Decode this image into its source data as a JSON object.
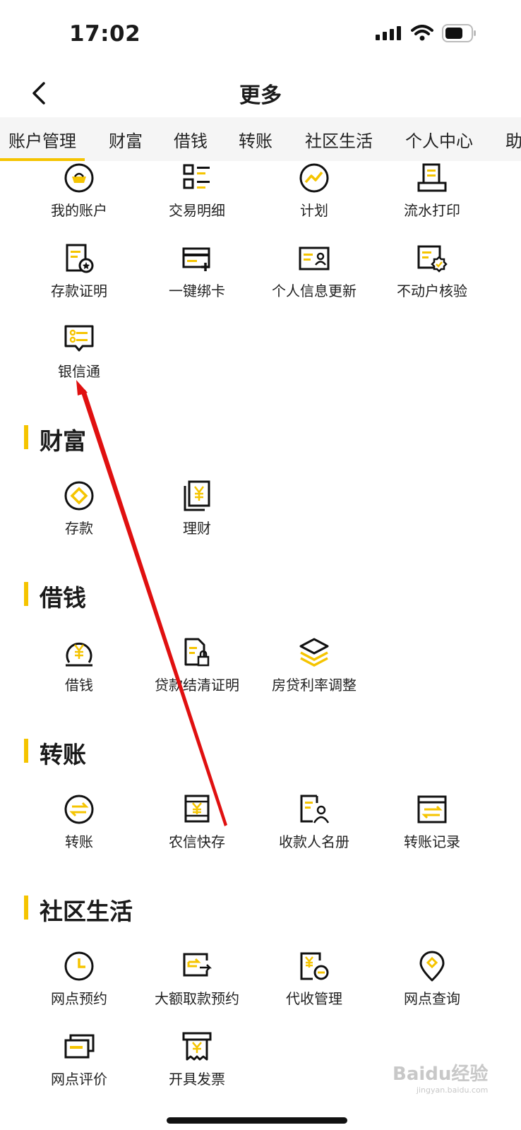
{
  "status_bar": {
    "time": "17:02"
  },
  "nav": {
    "title": "更多"
  },
  "tabs": [
    "账户管理",
    "财富",
    "借钱",
    "转账",
    "社区生活",
    "个人中心",
    "助"
  ],
  "account_items": [
    {
      "label": "我的账户",
      "icon": "gold-ingot-icon"
    },
    {
      "label": "交易明细",
      "icon": "list-icon"
    },
    {
      "label": "计划",
      "icon": "trend-circle-icon"
    },
    {
      "label": "流水打印",
      "icon": "printer-icon"
    },
    {
      "label": "存款证明",
      "icon": "certificate-icon"
    },
    {
      "label": "一键绑卡",
      "icon": "card-add-icon"
    },
    {
      "label": "个人信息更新",
      "icon": "id-card-icon"
    },
    {
      "label": "不动户核验",
      "icon": "verify-badge-icon"
    },
    {
      "label": "银信通",
      "icon": "message-icon"
    }
  ],
  "sections": [
    {
      "title": "财富",
      "items": [
        {
          "label": "存款",
          "icon": "deposit-icon"
        },
        {
          "label": "理财",
          "icon": "wealth-yen-icon"
        }
      ]
    },
    {
      "title": "借钱",
      "items": [
        {
          "label": "借钱",
          "icon": "yen-coin-icon"
        },
        {
          "label": "贷款结清证明",
          "icon": "loan-doc-icon"
        },
        {
          "label": "房贷利率调整",
          "icon": "layers-icon"
        }
      ]
    },
    {
      "title": "转账",
      "items": [
        {
          "label": "转账",
          "icon": "transfer-icon"
        },
        {
          "label": "农信快存",
          "icon": "quick-deposit-icon"
        },
        {
          "label": "收款人名册",
          "icon": "payee-icon"
        },
        {
          "label": "转账记录",
          "icon": "transfer-record-icon"
        }
      ]
    },
    {
      "title": "社区生活",
      "items": [
        {
          "label": "网点预约",
          "icon": "clock-icon"
        },
        {
          "label": "大额取款预约",
          "icon": "withdraw-icon"
        },
        {
          "label": "代收管理",
          "icon": "collection-icon"
        },
        {
          "label": "网点查询",
          "icon": "location-pin-icon"
        },
        {
          "label": "网点评价",
          "icon": "review-cards-icon"
        },
        {
          "label": "开具发票",
          "icon": "invoice-icon"
        }
      ]
    }
  ],
  "watermark": {
    "main": "Baidu经验",
    "sub": "jingyan.baidu.com"
  },
  "colors": {
    "accent": "#f5c400",
    "annotation_arrow": "#e01010"
  }
}
